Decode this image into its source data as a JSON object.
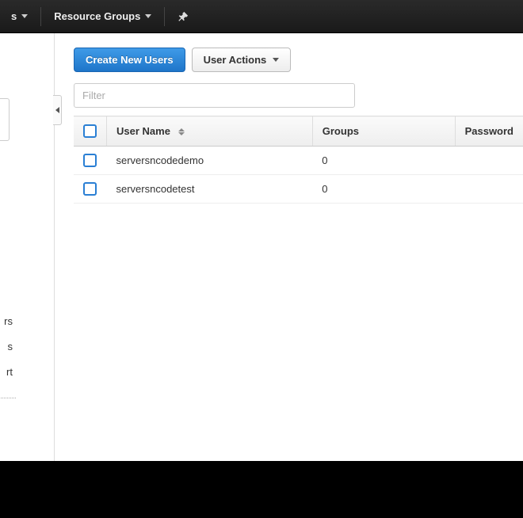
{
  "topnav": {
    "item1_suffix": "s",
    "item2_label": "Resource Groups"
  },
  "toolbar": {
    "create_label": "Create New Users",
    "actions_label": "User Actions"
  },
  "filter": {
    "placeholder": "Filter"
  },
  "table": {
    "headers": {
      "username": "User Name",
      "groups": "Groups",
      "password": "Password"
    },
    "rows": [
      {
        "username": "serversncodedemo",
        "groups": "0"
      },
      {
        "username": "serversncodetest",
        "groups": "0"
      }
    ]
  },
  "sidebar": {
    "frag1": "rs",
    "frag2": "s",
    "frag3": "rt"
  }
}
